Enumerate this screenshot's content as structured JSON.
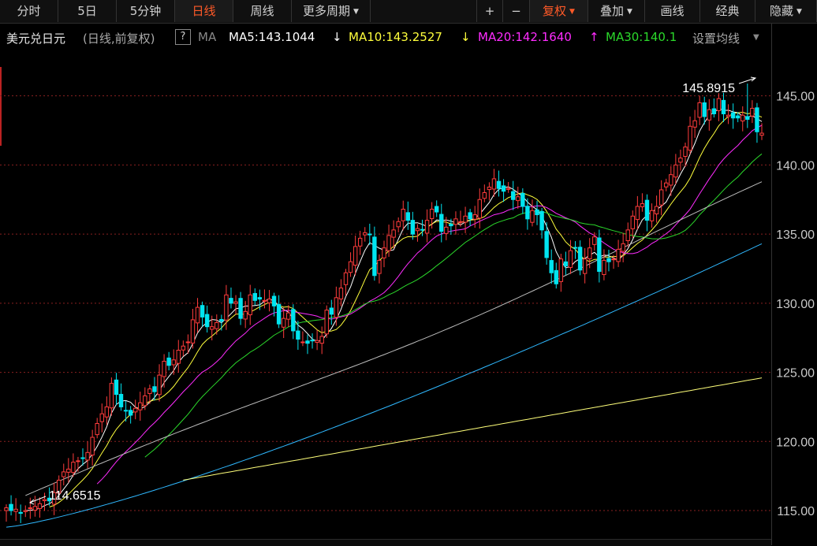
{
  "toolbar": {
    "tabs": [
      {
        "label": "分时",
        "active": false
      },
      {
        "label": "5日",
        "active": false
      },
      {
        "label": "5分钟",
        "active": false
      },
      {
        "label": "日线",
        "active": true
      },
      {
        "label": "周线",
        "active": false
      },
      {
        "label": "更多周期",
        "active": false,
        "dropdown": true
      }
    ],
    "right_buttons": [
      {
        "label": "+",
        "dropdown": false,
        "active": false
      },
      {
        "label": "−",
        "dropdown": false,
        "active": false
      },
      {
        "label": "复权",
        "dropdown": true,
        "active": true
      },
      {
        "label": "叠加",
        "dropdown": true,
        "active": false
      },
      {
        "label": "画线",
        "dropdown": false,
        "active": false
      },
      {
        "label": "经典",
        "dropdown": false,
        "active": false
      },
      {
        "label": "隐藏",
        "dropdown": true,
        "active": false
      }
    ]
  },
  "info": {
    "symbol": "美元兑日元",
    "mode": "(日线,前复权)",
    "help": "?",
    "ma_label": "MA",
    "ma5": {
      "text": "MA5:143.1044",
      "arrow": "↓",
      "color": "#ffffff"
    },
    "ma10": {
      "text": "MA10:143.2527",
      "arrow": "↓",
      "color": "#ffff3c"
    },
    "ma20": {
      "text": "MA20:142.1640",
      "arrow": "↑",
      "color": "#ff2cff"
    },
    "ma30": {
      "text": "MA30:140.1",
      "color": "#2bd92b"
    },
    "settings": "设置均线"
  },
  "colors": {
    "up": "#ff3c3c",
    "down": "#00e4f0",
    "grid": "#8a2020",
    "axis_text": "#c8c8c8"
  },
  "chart_data": {
    "type": "candlestick",
    "title": "美元兑日元",
    "y_ticks": [
      "145.00",
      "140.00",
      "135.00",
      "130.00",
      "125.00",
      "120.00",
      "115.00"
    ],
    "y_tick_values": [
      145,
      140,
      135,
      130,
      125,
      120,
      115
    ],
    "ylim": [
      112.95,
      148.4
    ],
    "high_annotation": "145.8915",
    "low_annotation": "114.6515",
    "ma_lines": [
      {
        "name": "MA5",
        "color": "#ffffff"
      },
      {
        "name": "MA10",
        "color": "#ffff3c"
      },
      {
        "name": "MA20",
        "color": "#ff2cff"
      },
      {
        "name": "MA30",
        "color": "#2bd92b"
      },
      {
        "name": "MA60",
        "color": "#bdbdbd"
      },
      {
        "name": "MA120",
        "color": "#2fb8ff"
      },
      {
        "name": "MA250",
        "color": "#ffff7a"
      }
    ],
    "closes": [
      115.2,
      115.0,
      115.1,
      114.8,
      115.0,
      115.2,
      115.3,
      115.5,
      115.8,
      115.7,
      116.3,
      117.2,
      117.8,
      118.0,
      118.5,
      118.6,
      118.8,
      119.2,
      120.3,
      121.3,
      122.0,
      122.5,
      124.2,
      123.4,
      122.5,
      122.2,
      121.9,
      122.4,
      122.8,
      123.3,
      123.8,
      123.6,
      124.8,
      125.8,
      125.5,
      125.9,
      126.6,
      126.9,
      127.2,
      128.8,
      129.7,
      129.0,
      128.3,
      128.3,
      128.6,
      128.7,
      130.6,
      130.0,
      130.1,
      128.9,
      129.4,
      130.6,
      130.2,
      130.3,
      130.2,
      130.3,
      129.8,
      128.5,
      128.9,
      129.3,
      128.0,
      127.4,
      127.2,
      127.1,
      127.3,
      127.3,
      127.6,
      129.5,
      129.2,
      130.4,
      131.1,
      132.2,
      133.0,
      134.1,
      134.7,
      135.1,
      135.0,
      132.0,
      133.1,
      134.0,
      134.9,
      135.3,
      135.9,
      136.8,
      136.0,
      135.0,
      135.4,
      135.3,
      136.0,
      136.8,
      136.6,
      135.2,
      135.5,
      135.6,
      136.1,
      135.9,
      136.3,
      136.1,
      136.4,
      137.5,
      138.0,
      138.4,
      139.0,
      138.3,
      138.1,
      138.3,
      137.5,
      137.7,
      137.0,
      136.1,
      136.7,
      136.4,
      135.3,
      133.3,
      132.2,
      131.4,
      133.2,
      132.7,
      133.8,
      134.0,
      132.4,
      133.2,
      134.0,
      134.8,
      132.3,
      133.1,
      133.0,
      133.2,
      133.9,
      134.3,
      135.3,
      136.3,
      137.0,
      137.2,
      136.0,
      136.7,
      137.0,
      138.2,
      138.7,
      139.3,
      140.0,
      140.5,
      141.3,
      142.8,
      143.2,
      144.5,
      143.5,
      144.0,
      143.7,
      144.8,
      143.7,
      143.6,
      143.4,
      143.4,
      143.6,
      143.3,
      144.1,
      142.4,
      142.3
    ]
  }
}
